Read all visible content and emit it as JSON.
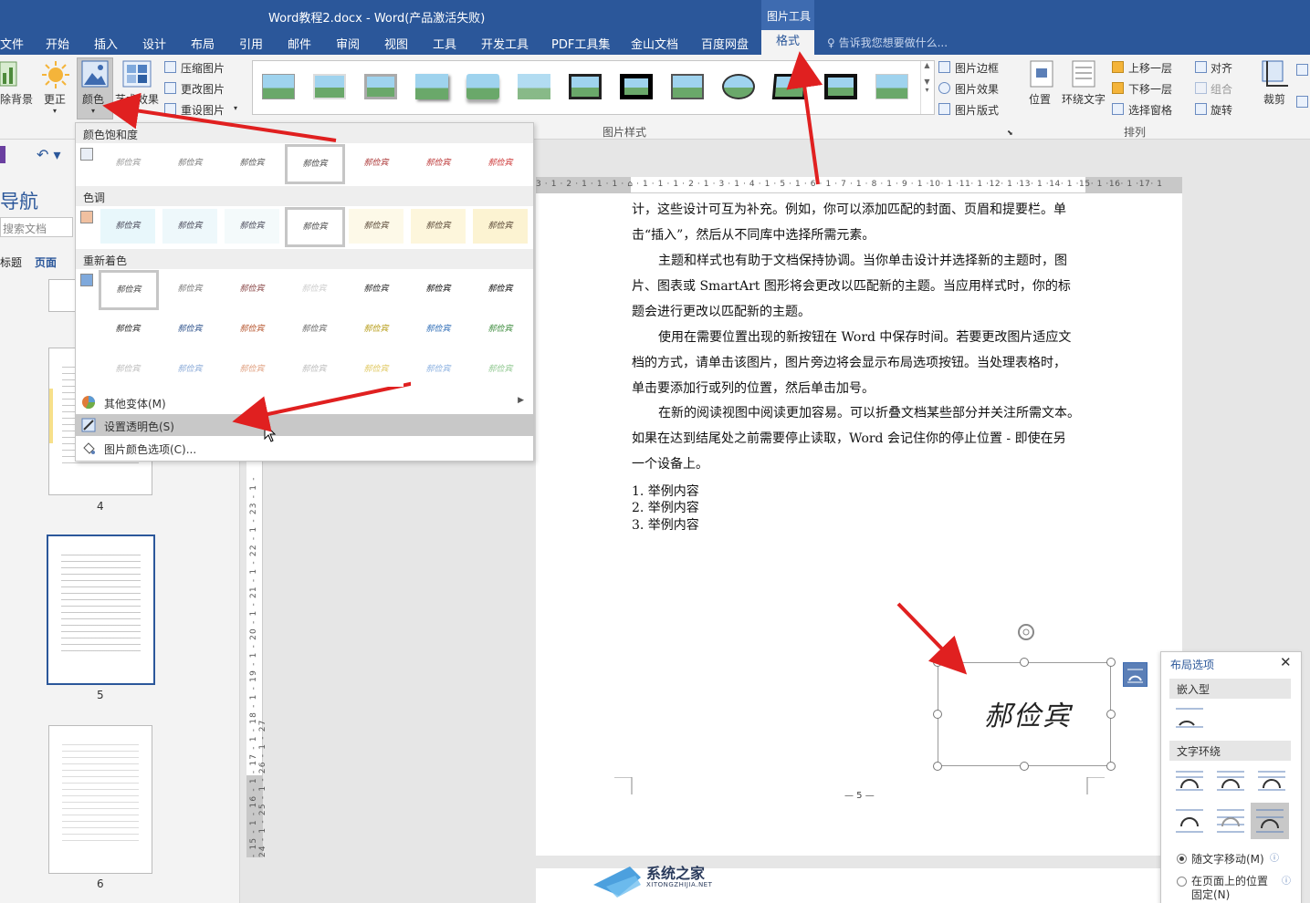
{
  "window": {
    "title": "Word教程2.docx - Word(产品激活失败)"
  },
  "context_tab": {
    "label": "图片工具"
  },
  "tabs": [
    {
      "label": "文件"
    },
    {
      "label": "开始"
    },
    {
      "label": "插入"
    },
    {
      "label": "设计"
    },
    {
      "label": "布局"
    },
    {
      "label": "引用"
    },
    {
      "label": "邮件"
    },
    {
      "label": "审阅"
    },
    {
      "label": "视图"
    },
    {
      "label": "工具"
    },
    {
      "label": "开发工具"
    },
    {
      "label": "PDF工具集"
    },
    {
      "label": "金山文档"
    },
    {
      "label": "百度网盘"
    },
    {
      "label": "格式"
    }
  ],
  "tell_me": "告诉我您想要做什么...",
  "ribbon": {
    "remove_bg": "除背景",
    "correct": "更正",
    "color": "颜色",
    "artistic": "艺术效果",
    "compress": "压缩图片",
    "change_pic": "更改图片",
    "reset_pic": "重设图片",
    "pic_styles_group": "图片样式",
    "pic_border": "图片边框",
    "pic_effects": "图片效果",
    "pic_layout": "图片版式",
    "position": "位置",
    "wrap_text": "环绕文字",
    "bring_forward": "上移一层",
    "send_backward": "下移一层",
    "selection_pane": "选择窗格",
    "align": "对齐",
    "group": "组合",
    "rotate": "旋转",
    "arrange_group": "排列",
    "crop": "裁剪"
  },
  "nav": {
    "title": "导航",
    "search_placeholder": "搜索文档",
    "tab_headings": "标题",
    "tab_pages": "页面",
    "page_numbers": [
      "4",
      "5",
      "6"
    ]
  },
  "ruler": {
    "h_ticks": "3 · 1 · 2 · 1 · 1 · 1 · ⌂ · 1 · 1 · 1 · 2 · 1 · 3 · 1 · 4 · 1 · 5 · 1 · 6 · 1 · 7 · 1 · 8 · 1 · 9 · 1 ·10· 1 ·11· 1 ·12· 1 ·13· 1 ·14· 1 ·15· 1 ·16· 1 ·17· 1",
    "v_ticks": "- 15 - 1 - 16 - 1 - 17 - 1 - 18 - 1 - 19 - 1 - 20 - 1 - 21 - 1 - 22 - 1 - 23 - 1 - 24 - 1 - 25 - 1 - 26 - 1 - 27"
  },
  "document": {
    "p1_line1": "计，这些设计可互为补充。例如，你可以添加匹配的封面、页眉和提要栏。单",
    "p1_line2": "击“插入”，然后从不同库中选择所需元素。",
    "p2_line1": "主题和样式也有助于文档保持协调。当你单击设计并选择新的主题时，图",
    "p2_line2": "片、图表或 SmartArt 图形将会更改以匹配新的主题。当应用样式时，你的标",
    "p2_line3": "题会进行更改以匹配新的主题。",
    "p3_line1": "使用在需要位置出现的新按钮在 Word 中保存时间。若要更改图片适应文",
    "p3_line2": "档的方式，请单击该图片，图片旁边将会显示布局选项按钮。当处理表格时，",
    "p3_line3": "单击要添加行或列的位置，然后单击加号。",
    "p4_line1": "在新的阅读视图中阅读更加容易。可以折叠文档某些部分并关注所需文本。",
    "p4_line2": "如果在达到结尾处之前需要停止读取，Word 会记住你的停止位置 - 即使在另",
    "p4_line3": "一个设备上。",
    "list": [
      "1. 举例内容",
      "2. 举例内容",
      "3. 举例内容"
    ],
    "footer": "— 5 —",
    "signature": "郝俭宾"
  },
  "color_menu": {
    "saturation": "颜色饱和度",
    "tone": "色调",
    "recolor": "重新着色",
    "swatch_text": "郝俭宾",
    "more_variants": "其他变体(M)",
    "set_transparent": "设置透明色(S)",
    "pic_color_options": "图片颜色选项(C)..."
  },
  "layout_panel": {
    "title": "布局选项",
    "inline_section": "嵌入型",
    "wrap_section": "文字环绕",
    "move_with_text": "随文字移动(M)",
    "fix_position_1": "在页面上的位置",
    "fix_position_2": "固定(N)"
  },
  "watermark": {
    "name": "系统之家",
    "url": "XITONGZHIJIA.NET"
  },
  "colors": {
    "accent": "#2b579a",
    "arrow": "#e02020"
  }
}
